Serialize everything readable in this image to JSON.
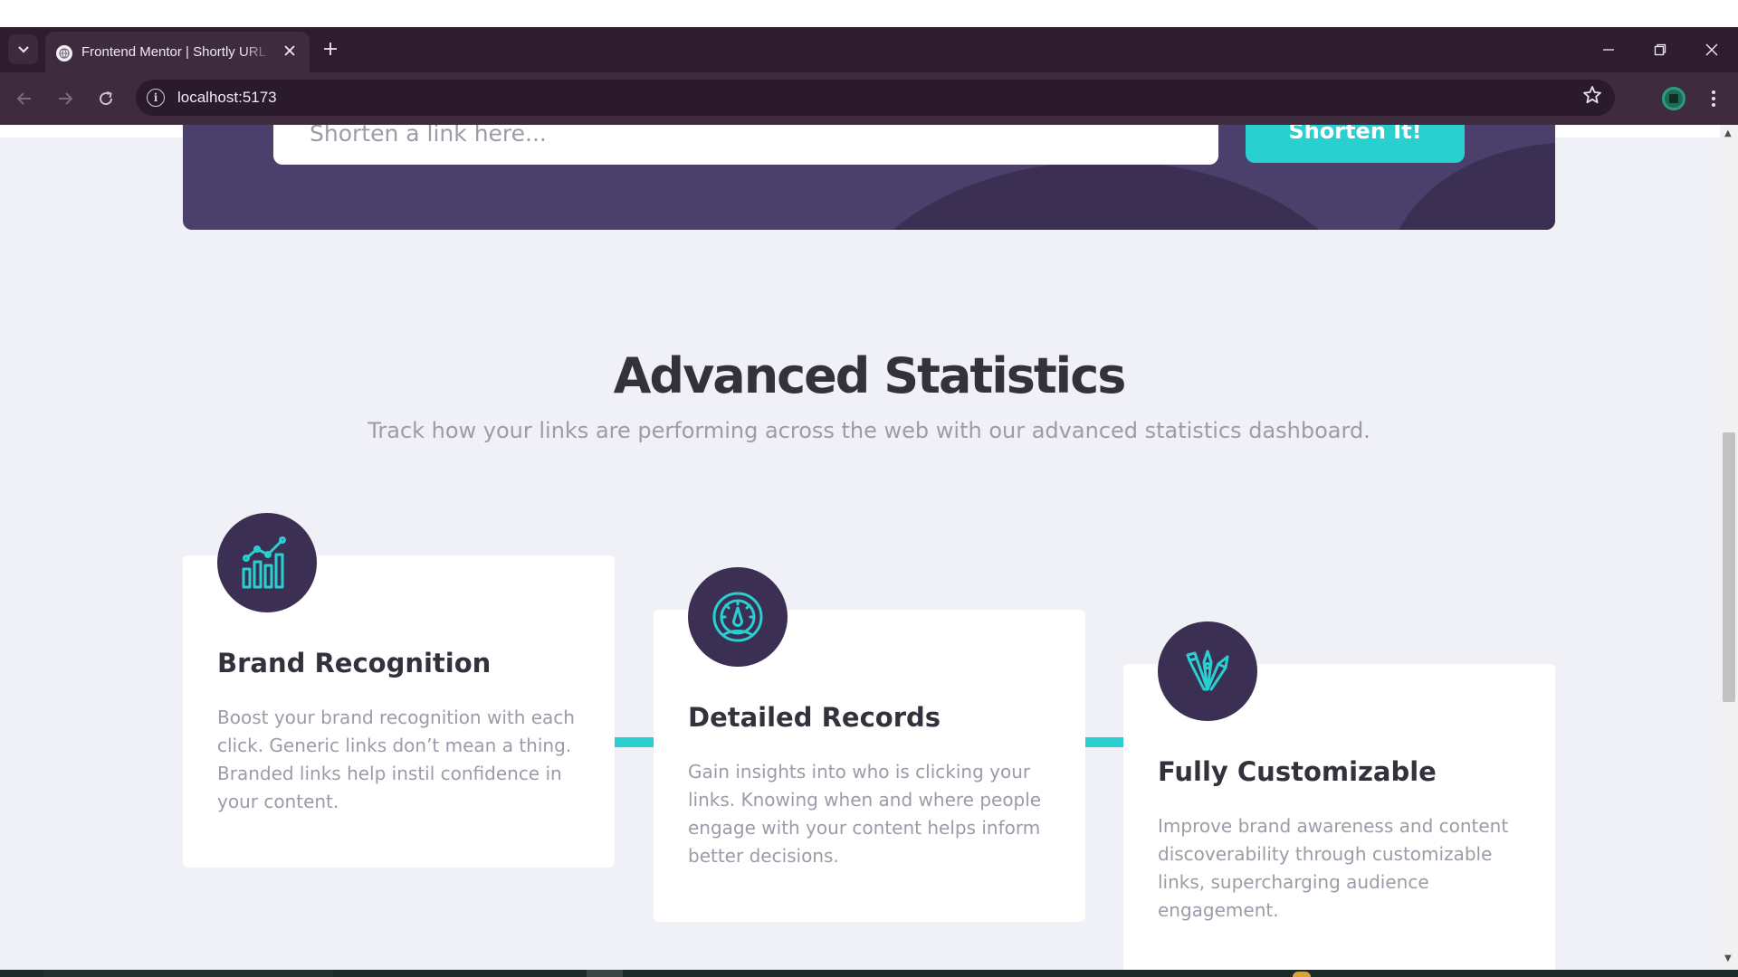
{
  "browser": {
    "tab_title": "Frontend Mentor | Shortly URL shortening API Challenge",
    "url": "localhost:5173",
    "icons": {
      "tab_list": "chevron-down-icon",
      "favicon": "globe-icon",
      "close_tab": "close-icon",
      "new_tab": "plus-icon",
      "minimize": "minimize-icon",
      "restore": "restore-icon",
      "close_window": "close-icon",
      "back": "back-arrow-icon",
      "forward": "forward-arrow-icon",
      "reload": "reload-icon",
      "site_info": "info-icon",
      "bookmark": "star-icon",
      "extension": "extension-icon",
      "menu": "kebab-menu-icon"
    }
  },
  "shorten": {
    "placeholder": "Shorten a link here...",
    "button_label": "Shorten It!"
  },
  "statistics": {
    "title": "Advanced Statistics",
    "subtitle": "Track how your links are performing across the web with our advanced statistics dashboard.",
    "cards": [
      {
        "icon": "brand-recognition-icon",
        "title": "Brand Recognition",
        "text": "Boost your brand recognition with each click. Generic links don’t mean a thing. Branded links help instil confidence in your content."
      },
      {
        "icon": "detailed-records-icon",
        "title": "Detailed Records",
        "text": "Gain insights into who is clicking your links. Knowing when and where people engage with your content helps inform better decisions."
      },
      {
        "icon": "fully-customizable-icon",
        "title": "Fully Customizable",
        "text": "Improve brand awareness and content discoverability through customizable links, supercharging audience engagement."
      }
    ]
  },
  "colors": {
    "cyan": "#2acfcf",
    "dark_violet": "#3b3054",
    "very_dark_blue": "#34313d",
    "grayish_violet": "#9e9aa7",
    "page_background": "#f0f1f6",
    "browser_frame": "#2f1d2f"
  }
}
